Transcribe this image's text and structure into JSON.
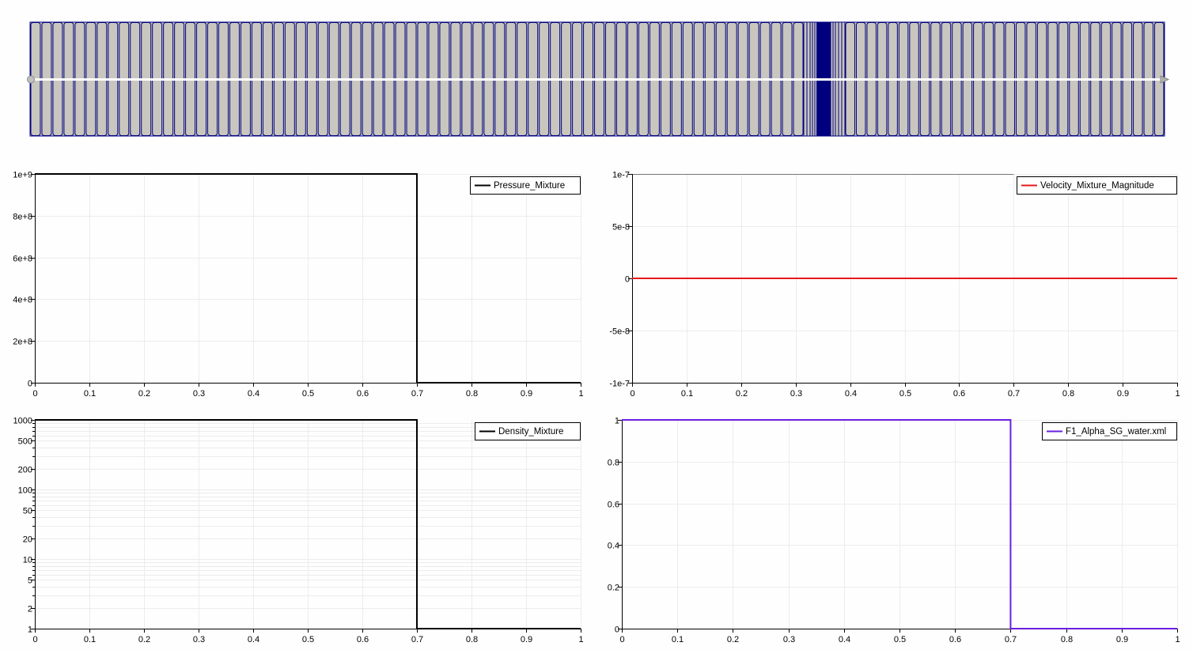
{
  "mesh_view": {
    "fill_color": "#c8c6be",
    "edge_color": "#00007f",
    "line_color": "#ffffff",
    "cells_left": 70,
    "cells_right": 30,
    "refined_cells": 40
  },
  "chart_data": [
    {
      "id": "pressure",
      "type": "line",
      "xlim": [
        0,
        1
      ],
      "ylim": [
        0,
        1000000000
      ],
      "yscale": "linear",
      "xticks": [
        "0",
        "0.1",
        "0.2",
        "0.3",
        "0.4",
        "0.5",
        "0.6",
        "0.7",
        "0.8",
        "0.9",
        "1"
      ],
      "yticks": [
        {
          "v": 0,
          "label": "0"
        },
        {
          "v": 200000000,
          "label": "2e+8"
        },
        {
          "v": 400000000,
          "label": "4e+8"
        },
        {
          "v": 600000000,
          "label": "6e+8"
        },
        {
          "v": 800000000,
          "label": "8e+8"
        },
        {
          "v": 1000000000,
          "label": "1e+9"
        }
      ],
      "grid": true,
      "legend_position": "top-right",
      "series": [
        {
          "name": "Pressure_Mixture",
          "color": "#000000",
          "x": [
            0,
            0.7,
            0.7,
            1
          ],
          "y": [
            1000000000,
            1000000000,
            100000,
            100000
          ]
        }
      ]
    },
    {
      "id": "velocity",
      "type": "line",
      "xlim": [
        0,
        1
      ],
      "ylim": [
        -1e-07,
        1e-07
      ],
      "yscale": "linear",
      "xticks": [
        "0",
        "0.1",
        "0.2",
        "0.3",
        "0.4",
        "0.5",
        "0.6",
        "0.7",
        "0.8",
        "0.9",
        "1"
      ],
      "yticks": [
        {
          "v": -1e-07,
          "label": "-1e-7"
        },
        {
          "v": -5e-08,
          "label": "-5e-8"
        },
        {
          "v": 0,
          "label": "0"
        },
        {
          "v": 5e-08,
          "label": "5e-8"
        },
        {
          "v": 1e-07,
          "label": "1e-7"
        }
      ],
      "grid": true,
      "legend_position": "top-right",
      "series": [
        {
          "name": "Velocity_Mixture_Magnitude",
          "color": "#e41a1c",
          "x": [
            0,
            1
          ],
          "y": [
            0,
            0
          ]
        }
      ]
    },
    {
      "id": "density",
      "type": "line",
      "xlim": [
        0,
        1
      ],
      "ylim": [
        1,
        1000
      ],
      "yscale": "log",
      "xticks": [
        "0",
        "0.1",
        "0.2",
        "0.3",
        "0.4",
        "0.5",
        "0.6",
        "0.7",
        "0.8",
        "0.9",
        "1"
      ],
      "yticks": [
        {
          "v": 1,
          "label": "1"
        },
        {
          "v": 2,
          "label": "2"
        },
        {
          "v": 5,
          "label": "5"
        },
        {
          "v": 10,
          "label": "10"
        },
        {
          "v": 20,
          "label": "20"
        },
        {
          "v": 50,
          "label": "50"
        },
        {
          "v": 100,
          "label": "100"
        },
        {
          "v": 200,
          "label": "200"
        },
        {
          "v": 500,
          "label": "500"
        },
        {
          "v": 1000,
          "label": "1000"
        }
      ],
      "grid": true,
      "legend_position": "top-right",
      "series": [
        {
          "name": "Density_Mixture",
          "color": "#000000",
          "x": [
            0,
            0.7,
            0.7,
            1
          ],
          "y": [
            1000,
            1000,
            1,
            1
          ]
        }
      ]
    },
    {
      "id": "alpha",
      "type": "line",
      "xlim": [
        0,
        1
      ],
      "ylim": [
        0,
        1
      ],
      "yscale": "linear",
      "xticks": [
        "0",
        "0.1",
        "0.2",
        "0.3",
        "0.4",
        "0.5",
        "0.6",
        "0.7",
        "0.8",
        "0.9",
        "1"
      ],
      "yticks": [
        {
          "v": 0,
          "label": "0"
        },
        {
          "v": 0.2,
          "label": "0.2"
        },
        {
          "v": 0.4,
          "label": "0.4"
        },
        {
          "v": 0.6,
          "label": "0.6"
        },
        {
          "v": 0.8,
          "label": "0.8"
        },
        {
          "v": 1,
          "label": "1"
        }
      ],
      "grid": true,
      "legend_position": "top-right",
      "series": [
        {
          "name": "F1_Alpha_SG_water.xml",
          "color": "#6a1fe0",
          "x": [
            0,
            0.7,
            0.7,
            1
          ],
          "y": [
            1,
            1,
            0,
            0
          ]
        }
      ]
    }
  ]
}
